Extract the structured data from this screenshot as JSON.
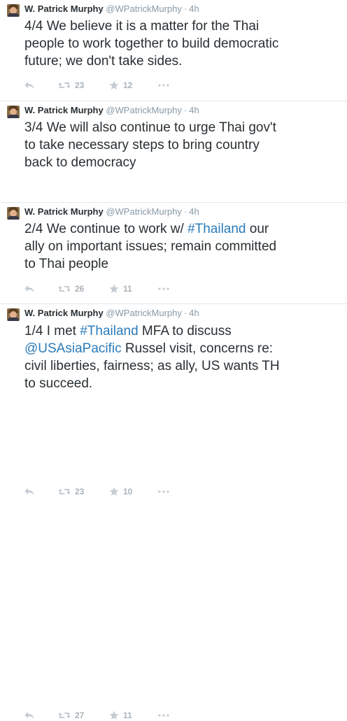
{
  "tweets": [
    {
      "name": "W. Patrick Murphy",
      "handle": "@WPatrickMurphy",
      "separator": "·",
      "time": "4h",
      "text": "4/4 We believe it is a matter for the Thai\npeople to work together to build democratic\nfuture; we don't take sides.",
      "retweets": "23",
      "favorites": "12"
    },
    {
      "name": "W. Patrick Murphy",
      "handle": "@WPatrickMurphy",
      "separator": "·",
      "time": "4h",
      "text": "3/4 We will also continue to urge Thai gov't\nto take necessary steps to bring country\nback to democracy",
      "retweets": "26",
      "favorites": "11"
    },
    {
      "name": "W. Patrick Murphy",
      "handle": "@WPatrickMurphy",
      "separator": "·",
      "time": "4h",
      "text_before": "2/4 We continue to work w/ ",
      "hashtag": "#Thailand",
      "text_after": " our\nally on important issues; remain committed\nto Thai people",
      "retweets": "23",
      "favorites": "10"
    },
    {
      "name": "W. Patrick Murphy",
      "handle": "@WPatrickMurphy",
      "separator": "·",
      "time": "4h",
      "text_before": "1/4 I met ",
      "hashtag": "#Thailand",
      "text_middle": " MFA to discuss\n",
      "mention": "@USAsiaPacific",
      "text_after": " Russel visit, concerns re:\ncivil liberties, fairness; as ally, US wants TH\nto succeed.",
      "retweets": "27",
      "favorites": "11"
    }
  ],
  "colors": {
    "link": "#2b7bb9",
    "text": "#292f33",
    "muted": "#8899a6",
    "icon": "#bbc3c9",
    "divider": "#e1e8ed"
  },
  "icons": [
    "reply-icon",
    "retweet-icon",
    "favorite-icon",
    "more-icon",
    "avatar"
  ]
}
